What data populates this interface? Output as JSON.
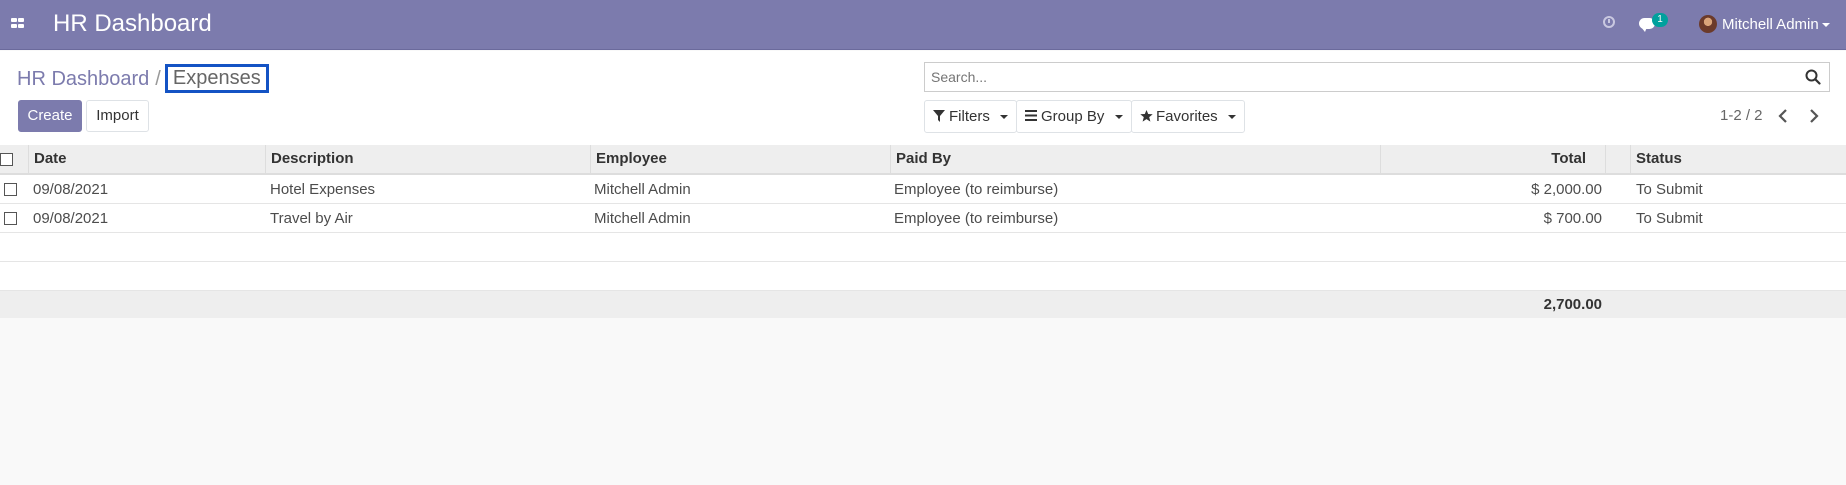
{
  "navbar": {
    "app_title": "HR Dashboard",
    "messages_count": "1",
    "user_name": "Mitchell Admin",
    "apps_icon": "grid-icon",
    "activity_icon": "clock-icon",
    "messages_icon": "chat-icon"
  },
  "breadcrumb": {
    "parent": "HR Dashboard",
    "separator": "/",
    "current": "Expenses"
  },
  "buttons": {
    "create": "Create",
    "import": "Import"
  },
  "search": {
    "placeholder": "Search...",
    "filters": "Filters",
    "group_by": "Group By",
    "favorites": "Favorites"
  },
  "pager": {
    "text": "1-2 / 2"
  },
  "table": {
    "columns": [
      "Date",
      "Description",
      "Employee",
      "Paid By",
      "Total",
      "Status"
    ],
    "rows": [
      {
        "date": "09/08/2021",
        "description": "Hotel Expenses",
        "employee": "Mitchell Admin",
        "paid_by": "Employee (to reimburse)",
        "total": "$ 2,000.00",
        "status": "To Submit"
      },
      {
        "date": "09/08/2021",
        "description": "Travel by Air",
        "employee": "Mitchell Admin",
        "paid_by": "Employee (to reimburse)",
        "total": "$ 700.00",
        "status": "To Submit"
      }
    ],
    "footer_total": "2,700.00"
  },
  "colors": {
    "brand": "#7c7bad",
    "highlight_border": "#1453c4",
    "badge": "#00a09d"
  }
}
